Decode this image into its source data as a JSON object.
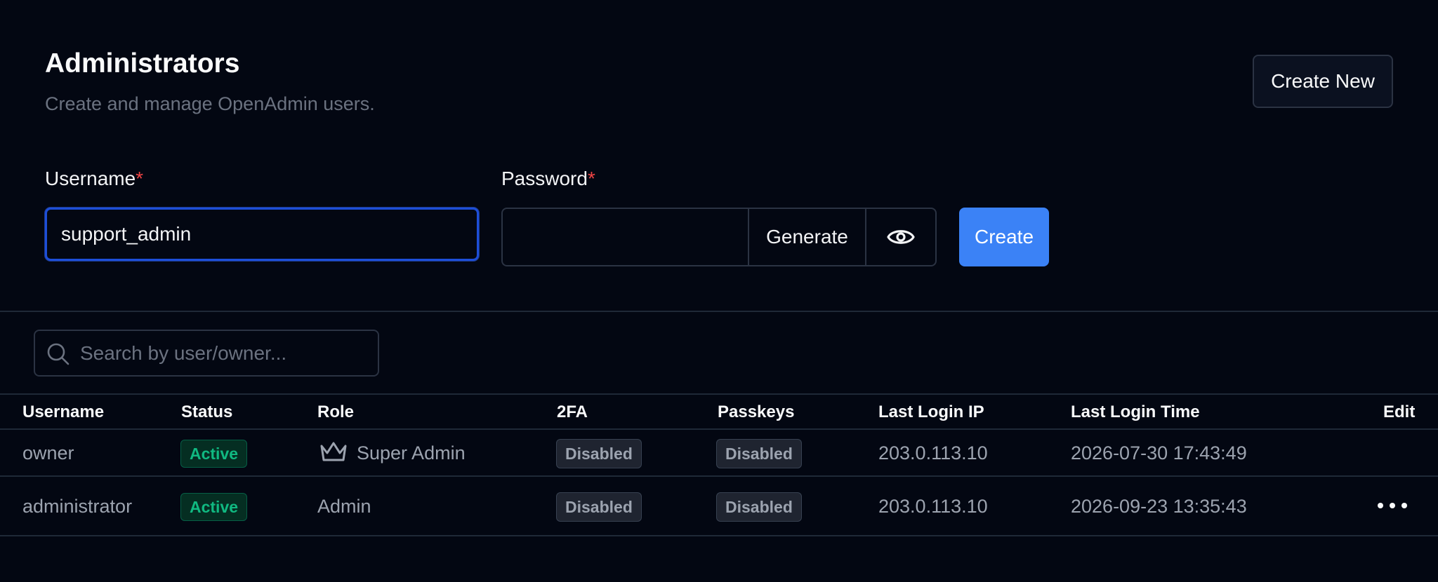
{
  "header": {
    "title": "Administrators",
    "subtitle": "Create and manage OpenAdmin users.",
    "create_new_label": "Create New"
  },
  "form": {
    "username_label": "Username",
    "password_label": "Password",
    "required_mark": "*",
    "username_value": "support_admin",
    "password_value": "",
    "generate_label": "Generate",
    "create_label": "Create"
  },
  "search": {
    "placeholder": "Search by user/owner..."
  },
  "table": {
    "columns": [
      "Username",
      "Status",
      "Role",
      "2FA",
      "Passkeys",
      "Last Login IP",
      "Last Login Time",
      "Edit"
    ],
    "rows": [
      {
        "username": "owner",
        "status": "Active",
        "role": "Super Admin",
        "role_icon": "crown-icon",
        "two_fa": "Disabled",
        "passkeys": "Disabled",
        "last_login_ip": "203.0.113.10",
        "last_login_time": "2026-07-30 17:43:49"
      },
      {
        "username": "administrator",
        "status": "Active",
        "role": "Admin",
        "two_fa": "Disabled",
        "passkeys": "Disabled",
        "last_login_ip": "203.0.113.10",
        "last_login_time": "2026-09-23 13:35:43",
        "edit_icon": "more-horizontal-icon"
      }
    ]
  },
  "colors": {
    "background": "#030712",
    "primary": "#3b82f6",
    "active_green": "#10b981",
    "required_red": "#ef4444"
  }
}
